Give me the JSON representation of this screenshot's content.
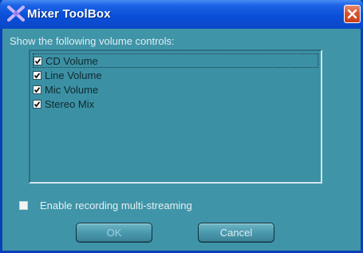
{
  "window": {
    "title": "Mixer ToolBox",
    "icon": "mixer-app-icon",
    "close_icon": "close-icon"
  },
  "dialog": {
    "prompt": "Show the following volume controls:",
    "controls": [
      {
        "label": "CD Volume",
        "checked": true
      },
      {
        "label": "Line Volume",
        "checked": true
      },
      {
        "label": "Mic Volume",
        "checked": true
      },
      {
        "label": "Stereo Mix",
        "checked": true
      }
    ],
    "multistream_label": "Enable recording multi-streaming",
    "multistream_checked": false,
    "ok_label": "OK",
    "cancel_label": "Cancel"
  },
  "colors": {
    "title_bar": "#0a4fd8",
    "dialog_bg": "#3f94a8",
    "close_button": "#d8532e"
  }
}
